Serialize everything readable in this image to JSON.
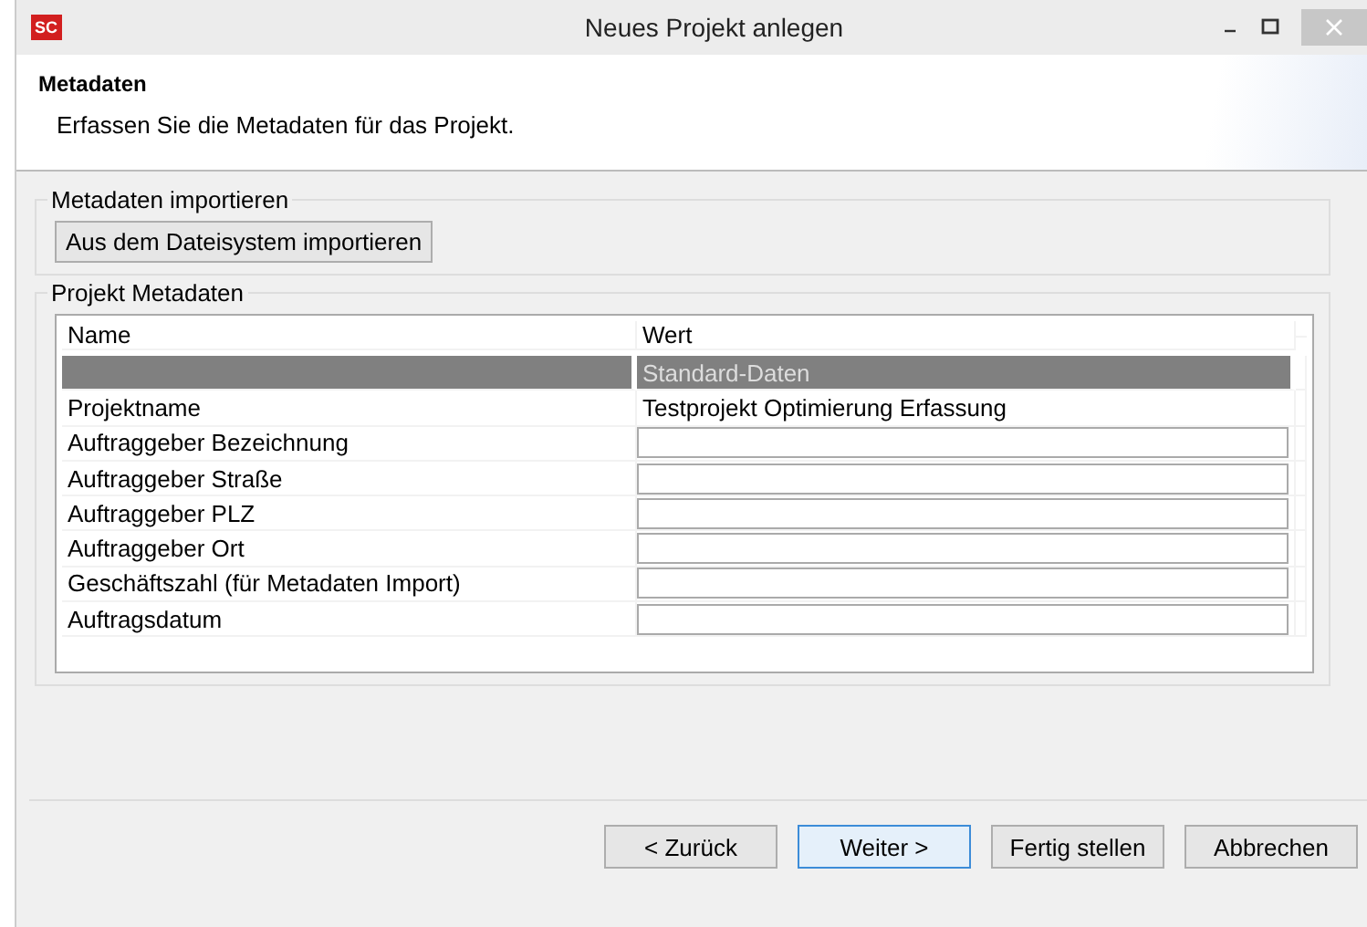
{
  "window": {
    "logo": "SC",
    "title": "Neues Projekt anlegen"
  },
  "header": {
    "title": "Metadaten",
    "description": "Erfassen Sie die Metadaten für das Projekt."
  },
  "import_group": {
    "title": "Metadaten importieren",
    "button": "Aus dem Dateisystem importieren"
  },
  "metadata_group": {
    "title": "Projekt Metadaten",
    "columns": [
      "Name",
      "Wert"
    ],
    "rows": [
      {
        "kind": "group",
        "name": "",
        "value": "Standard-Daten"
      },
      {
        "kind": "text",
        "name": "Projektname",
        "value": "Testprojekt Optimierung Erfassung"
      },
      {
        "kind": "input",
        "name": "Auftraggeber Bezeichnung",
        "value": ""
      },
      {
        "kind": "input",
        "name": "Auftraggeber Straße",
        "value": ""
      },
      {
        "kind": "input",
        "name": "Auftraggeber PLZ",
        "value": ""
      },
      {
        "kind": "input",
        "name": "Auftraggeber Ort",
        "value": ""
      },
      {
        "kind": "input",
        "name": "Geschäftszahl (für Metadaten Import)",
        "value": ""
      },
      {
        "kind": "input",
        "name": "Auftragsdatum",
        "value": ""
      }
    ]
  },
  "buttons": [
    {
      "label": "< Zurück",
      "default": false
    },
    {
      "label": "Weiter >",
      "default": true
    },
    {
      "label": "Fertig stellen",
      "default": false
    },
    {
      "label": "Abbrechen",
      "default": false
    }
  ]
}
